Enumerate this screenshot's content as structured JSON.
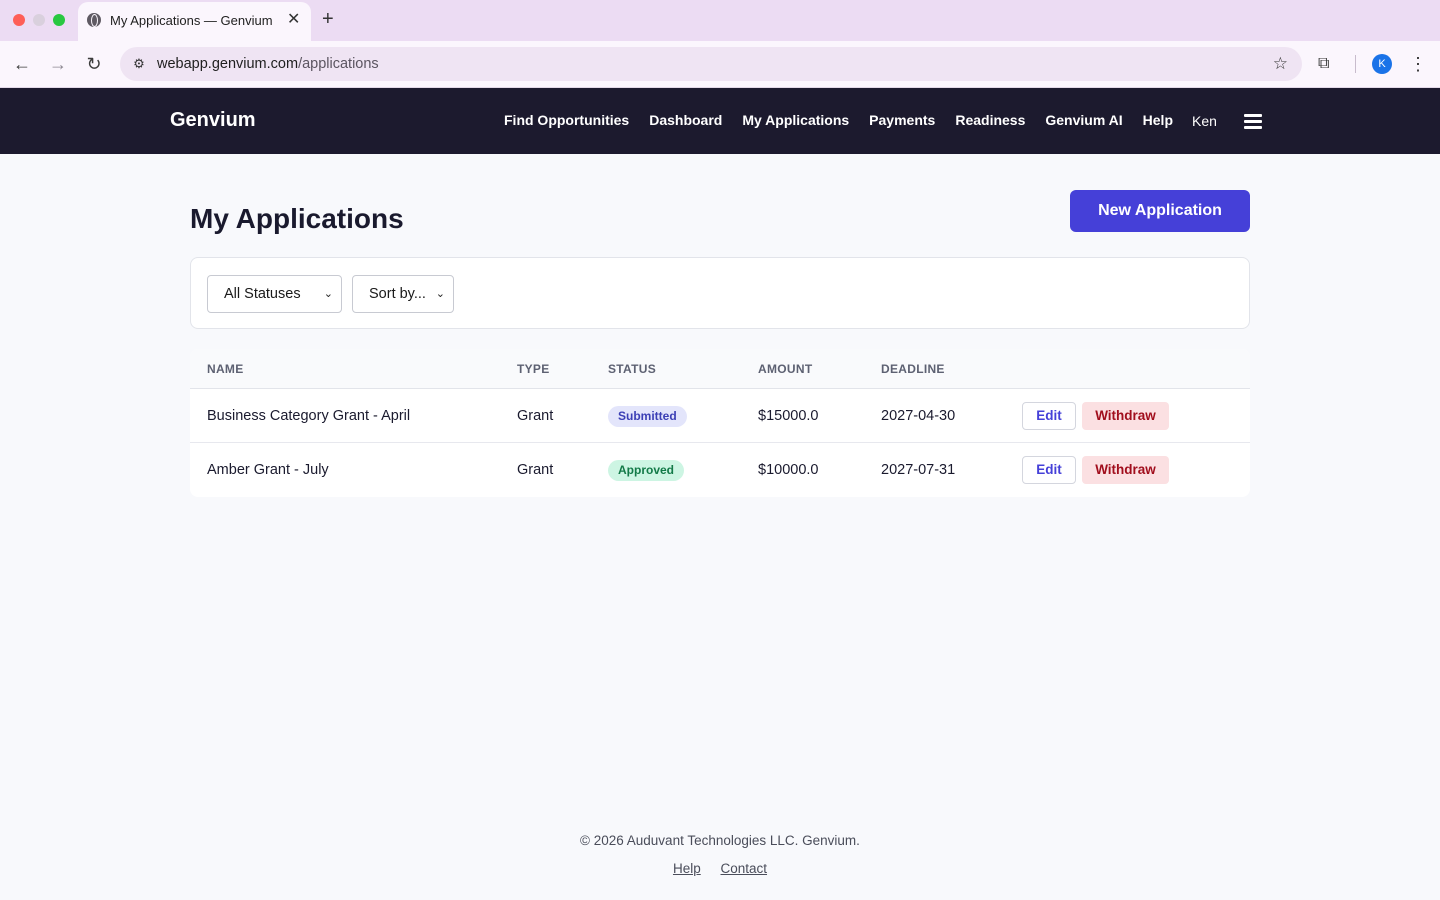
{
  "browser": {
    "tab_title": "My Applications — Genvium",
    "url_host": "webapp.genvium.com",
    "url_path": "/applications",
    "profile_initial": "K"
  },
  "nav": {
    "brand": "Genvium",
    "links": [
      "Find Opportunities",
      "Dashboard",
      "My Applications",
      "Payments",
      "Readiness",
      "Genvium AI",
      "Help"
    ],
    "user": "Ken"
  },
  "page": {
    "title": "My Applications",
    "new_button": "New Application"
  },
  "filters": {
    "status": "All Statuses",
    "sort": "Sort by..."
  },
  "table": {
    "headers": [
      "NAME",
      "TYPE",
      "STATUS",
      "AMOUNT",
      "DEADLINE"
    ],
    "rows": [
      {
        "name": "Business Category Grant - April",
        "type": "Grant",
        "status": "Submitted",
        "amount": "$15000.0",
        "deadline": "2027-04-30",
        "edit": "Edit",
        "withdraw": "Withdraw"
      },
      {
        "name": "Amber Grant - July",
        "type": "Grant",
        "status": "Approved",
        "amount": "$10000.0",
        "deadline": "2027-07-31",
        "edit": "Edit",
        "withdraw": "Withdraw"
      }
    ]
  },
  "footer": {
    "copyright": "© 2026 Auduvant Technologies LLC. Genvium.",
    "links": [
      "Help",
      "Contact"
    ]
  },
  "colors": {
    "nav_bg": "#1c1a2e",
    "accent": "#4540d8",
    "submitted_bg": "#e3e5fb",
    "approved_bg": "#cdf5e3",
    "withdraw_bg": "#fbe0e2"
  }
}
